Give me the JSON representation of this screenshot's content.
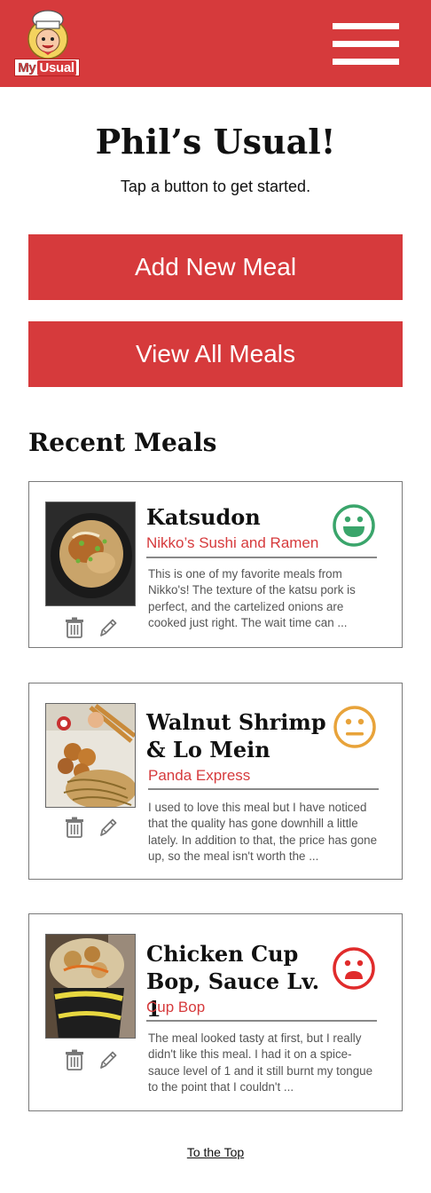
{
  "header": {
    "logo": {
      "word_my": "My",
      "word_usual": "Usual",
      "image": "chef-mascot"
    },
    "menu_icon": "hamburger-menu-icon"
  },
  "main": {
    "title": "Phil’s Usual!",
    "subtitle": "Tap a button to get started.",
    "buttons": {
      "add": "Add New Meal",
      "view": "View All Meals"
    },
    "recent_title": "Recent Meals"
  },
  "meals": [
    {
      "title": "Katsudon",
      "restaurant": "Nikko’s Sushi and Ramen",
      "rating": "happy",
      "rating_color": "#3aa56b",
      "description": "This is one of my favorite meals from Nikko's! The texture of the katsu pork is perfect, and the cartelized onions are cooked just right. The wait time can ..."
    },
    {
      "title": "Walnut Shrimp & Lo Mein",
      "restaurant": "Panda Express",
      "rating": "neutral",
      "rating_color": "#e8a33a",
      "description": "I used to love this meal but I have noticed that the quality has gone downhill a little lately. In addition to that, the price has gone up, so the meal isn't worth the ..."
    },
    {
      "title": "Chicken Cup Bop, Sauce Lv. 1",
      "restaurant": "Cup Bop",
      "rating": "sad",
      "rating_color": "#e02b2b",
      "description": "The meal looked tasty at first, but I really didn't like this meal. I had it on a spice-sauce level of 1 and it still burnt my tongue to the point that I couldn't ..."
    }
  ],
  "footer": {
    "to_top": "To the Top"
  },
  "colors": {
    "brand_red": "#d63a3c",
    "text_gray": "#555555"
  },
  "icons": {
    "delete": "trash-icon",
    "edit": "pencil-icon"
  }
}
